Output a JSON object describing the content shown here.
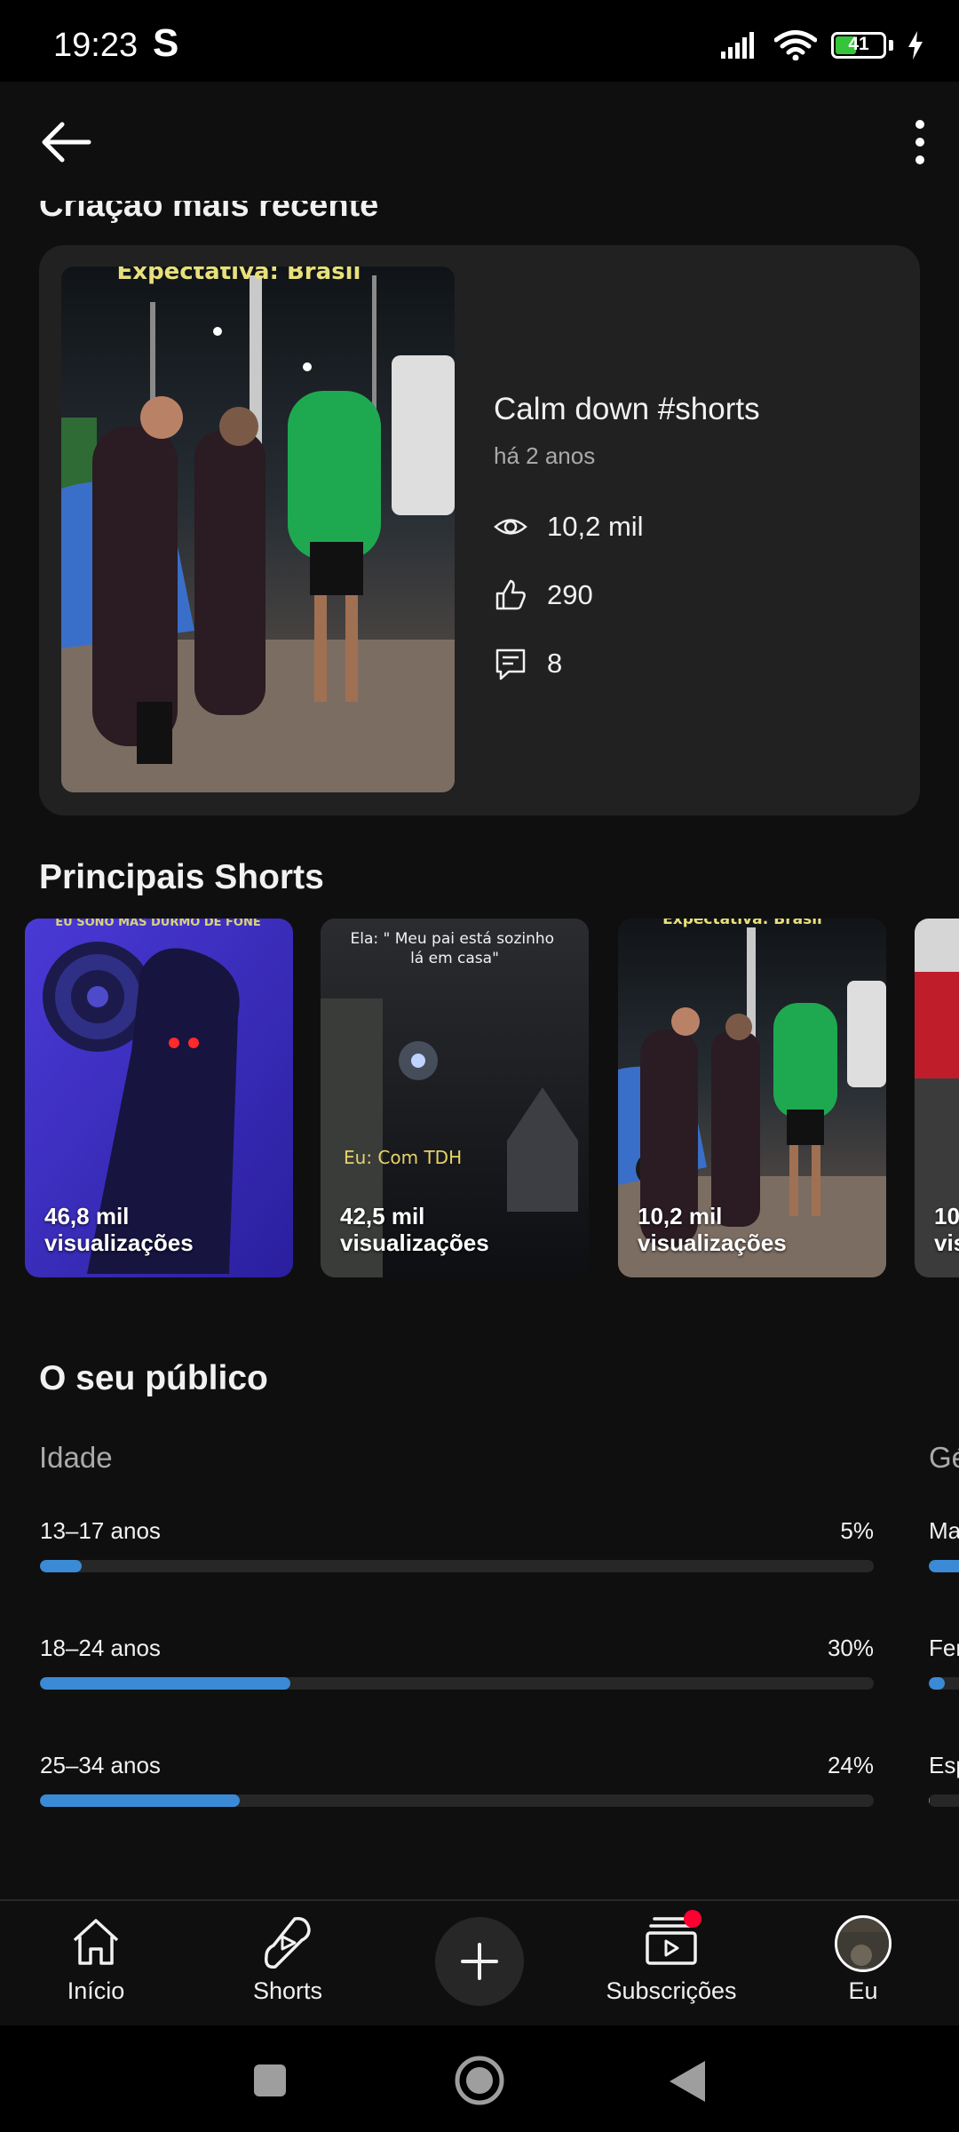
{
  "status_bar": {
    "time": "19:23",
    "carrier_glyph": "S",
    "battery": "41",
    "battery_level": 0.41
  },
  "app_bar": {
    "back_icon": "arrow-left-icon",
    "more_icon": "more-vert-icon"
  },
  "latest": {
    "section_title": "Criação mais recente",
    "video_title": "Calm down #shorts",
    "age": "há 2 anos",
    "thumb_overlay": "Expectativa: Brasil",
    "views": "10,2 mil",
    "likes": "290",
    "comments": "8"
  },
  "top_shorts": {
    "section_title": "Principais Shorts",
    "items": [
      {
        "views": "46,8 mil",
        "views_unit": "visualizações",
        "overlay_top": "EU SONO MAS DURMO DE FONE",
        "overlay_mid": ""
      },
      {
        "views": "42,5 mil",
        "views_unit": "visualizações",
        "overlay_top": "Ela: \" Meu pai está sozinho lá em casa\"",
        "overlay_mid": "Eu: Com TDH"
      },
      {
        "views": "10,2 mil",
        "views_unit": "visualizações",
        "overlay_top": "Expectativa: Brasil",
        "overlay_mid": ""
      },
      {
        "views": "10",
        "views_unit": "vis",
        "overlay_top": "",
        "overlay_mid": ""
      }
    ]
  },
  "audience": {
    "section_title": "O seu público",
    "age_tab": "Idade",
    "gender_tab": "Gé",
    "age_bars": [
      {
        "label": "13–17 anos",
        "percent": "5%",
        "value": 5
      },
      {
        "label": "18–24 anos",
        "percent": "30%",
        "value": 30
      },
      {
        "label": "25–34 anos",
        "percent": "24%",
        "value": 24
      }
    ],
    "gender_bars": [
      {
        "label": "Ma",
        "value": 70
      },
      {
        "label": "Fer",
        "value": 30
      },
      {
        "label": "Esp",
        "value": 2
      }
    ]
  },
  "bottom_nav": {
    "items": [
      {
        "label": "Início",
        "icon": "home-icon"
      },
      {
        "label": "Shorts",
        "icon": "shorts-icon"
      },
      {
        "label": "",
        "icon": "plus-icon"
      },
      {
        "label": "Subscrições",
        "icon": "subscriptions-icon"
      },
      {
        "label": "Eu",
        "icon": "avatar"
      }
    ]
  },
  "colors": {
    "accent": "#3a8ad6",
    "background": "#0f0f0f",
    "card": "#212121",
    "notification": "#ff0033"
  }
}
